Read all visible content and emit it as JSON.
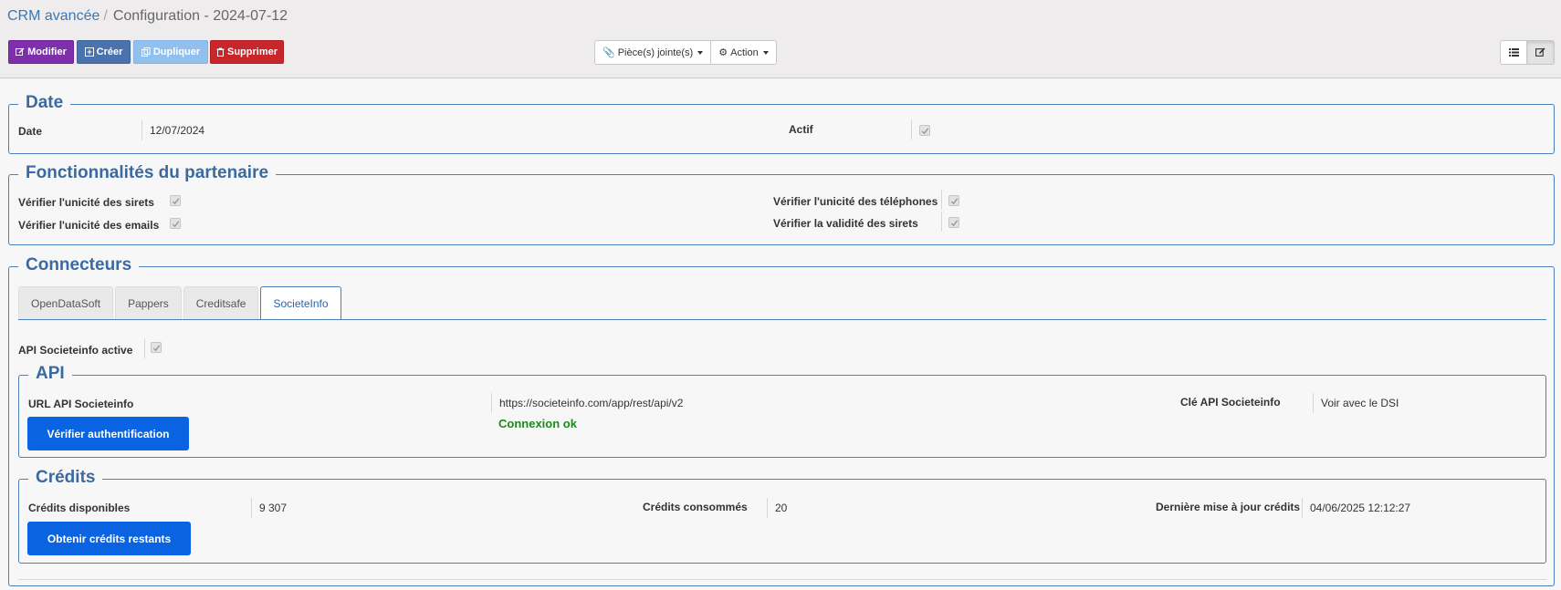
{
  "breadcrumb": {
    "link": "CRM avancée",
    "separator": "/",
    "current": "Configuration - 2024-07-12"
  },
  "toolbar": {
    "modifier": "Modifier",
    "creer": "Créer",
    "dupliquer": "Dupliquer",
    "supprimer": "Supprimer",
    "pieces_jointes": "Pièce(s) jointe(s)",
    "action": "Action"
  },
  "date_section": {
    "legend": "Date",
    "date_label": "Date",
    "date_value": "12/07/2024",
    "actif_label": "Actif",
    "actif_checked": true
  },
  "features_section": {
    "legend": "Fonctionnalités du partenaire",
    "sirets_unique": "Vérifier l'unicité des sirets",
    "emails_unique": "Vérifier l'unicité des emails",
    "phones_unique": "Vérifier l'unicité des téléphones",
    "sirets_valid": "Vérifier la validité des sirets"
  },
  "connectors_section": {
    "legend": "Connecteurs",
    "tabs": [
      "OpenDataSoft",
      "Pappers",
      "Creditsafe",
      "SocieteInfo"
    ],
    "active_tab": "SocieteInfo",
    "api_active_label": "API Societeinfo active",
    "api": {
      "legend": "API",
      "url_label": "URL API Societeinfo",
      "url_value": "https://societeinfo.com/app/rest/api/v2",
      "verify_button": "Vérifier authentification",
      "status": "Connexion ok",
      "key_label": "Clé API Societeinfo",
      "key_value": "Voir avec le DSI"
    },
    "credits": {
      "legend": "Crédits",
      "available_label": "Crédits disponibles",
      "available_value": "9 307",
      "consumed_label": "Crédits consommés",
      "consumed_value": "20",
      "last_update_label": "Dernière mise à jour crédits",
      "last_update_value": "04/06/2025 12:12:27",
      "get_button": "Obtenir crédits restants"
    }
  },
  "colors": {
    "primary": "#0a63e0",
    "legend": "#3a6aa0",
    "ok": "#1a8a1a"
  }
}
